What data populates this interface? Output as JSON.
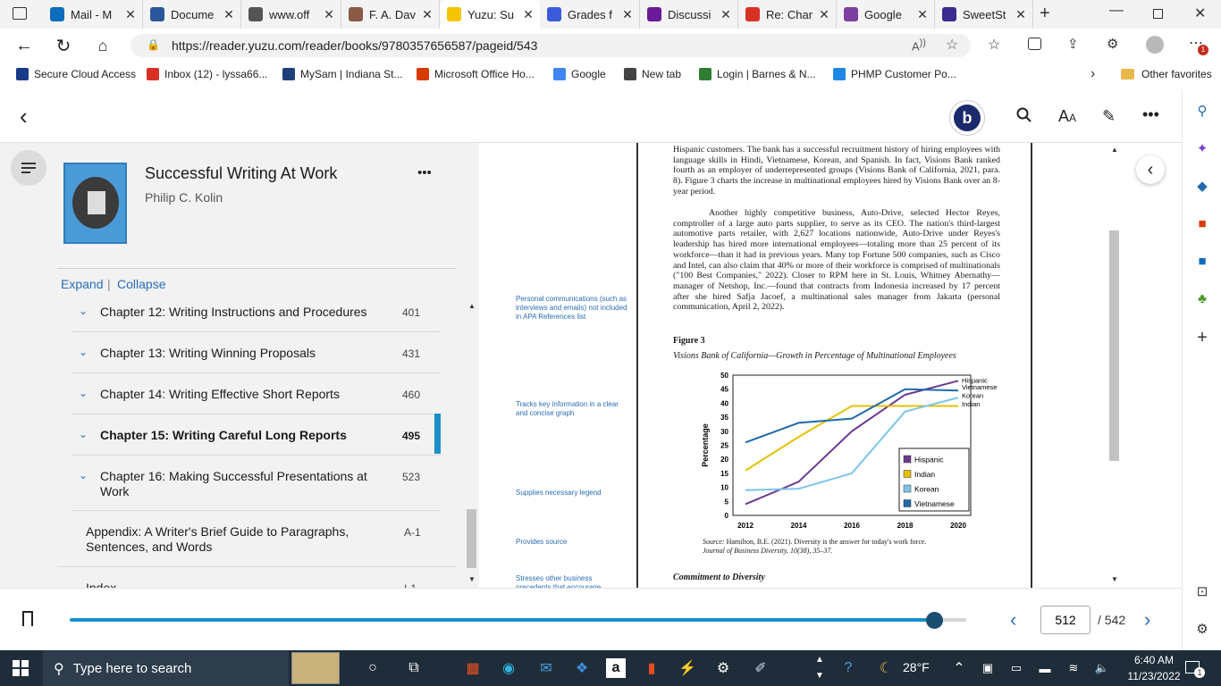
{
  "browser": {
    "tabs": [
      {
        "title": "Mail - M",
        "favicon": "outlook-icon",
        "color": "#0f6cbd"
      },
      {
        "title": "Docume",
        "favicon": "word-icon",
        "color": "#2b579a"
      },
      {
        "title": "www.off",
        "favicon": "document-icon",
        "color": "#555555"
      },
      {
        "title": "F. A. Dav",
        "favicon": "fa-davis-icon",
        "color": "#8a5a44"
      },
      {
        "title": "Yuzu: Su",
        "favicon": "yuzu-icon",
        "color": "#f5c400"
      },
      {
        "title": "Grades f",
        "favicon": "canvas-icon",
        "color": "#3b5bdb"
      },
      {
        "title": "Discussi",
        "favicon": "discussion-icon",
        "color": "#6a1b9a"
      },
      {
        "title": "Re: Char",
        "favicon": "gmail-icon",
        "color": "#d93025"
      },
      {
        "title": "Google",
        "favicon": "google-icon",
        "color": "#7b3fa0"
      },
      {
        "title": "SweetSt",
        "favicon": "sweetstudy-icon",
        "color": "#3b2a8f"
      }
    ],
    "url": "https://reader.yuzu.com/reader/books/9780357656587/pageid/543",
    "bookmarks": [
      {
        "label": "Secure Cloud Access",
        "color": "#1a3a8a"
      },
      {
        "label": "Inbox (12) - lyssa66...",
        "color": "#d93025"
      },
      {
        "label": "MySam | Indiana St...",
        "color": "#1f3f7a"
      },
      {
        "label": "Microsoft Office Ho...",
        "color": "#d83b01"
      },
      {
        "label": "Google",
        "color": "#4285f4"
      },
      {
        "label": "New tab",
        "color": "#444444"
      },
      {
        "label": "Login | Barnes & N...",
        "color": "#2e7d32"
      },
      {
        "label": "PHMP Customer Po...",
        "color": "#1e88e5"
      }
    ],
    "other_favorites": "Other favorites"
  },
  "reader": {
    "back_icon": "chevron-left-icon",
    "brand_letter": "b",
    "book_title": "Successful Writing At Work",
    "author": "Philip C. Kolin",
    "more_label": "•••",
    "expand_label": "Expand",
    "collapse_label": "Collapse",
    "separator": "|",
    "chapters": [
      {
        "label": "Chapter 12: Writing Instructions and Procedures",
        "page": "401",
        "chevron": true,
        "active": false
      },
      {
        "label": "Chapter 13: Writing Winning Proposals",
        "page": "431",
        "chevron": true,
        "active": false
      },
      {
        "label": "Chapter 14: Writing Effective Short Reports",
        "page": "460",
        "chevron": true,
        "active": false
      },
      {
        "label": "Chapter 15: Writing Careful Long Reports",
        "page": "495",
        "chevron": true,
        "active": true
      },
      {
        "label": "Chapter 16: Making Successful Presentations at Work",
        "page": "523",
        "chevron": true,
        "active": false
      },
      {
        "label": "Appendix: A Writer's Brief Guide to Paragraphs, Sentences, and Words",
        "page": "A-1",
        "chevron": false,
        "active": false
      },
      {
        "label": "Index",
        "page": "I-1",
        "chevron": false,
        "active": false
      }
    ],
    "page_input": "512",
    "page_total": "/ 542",
    "progress": 0.965,
    "accent": "#1a8fc9"
  },
  "page": {
    "para1": "Hispanic customers. The bank has a successful recruitment history of hiring employees with language skills in Hindi, Vietnamese, Korean, and Spanish. In fact, Visions Bank ranked fourth as an employer of underrepresented groups (Visions Bank of California, 2021, para. 8). Figure 3 charts the increase in multinational employees hired by Visions Bank over an 8-year period.",
    "para2": "Another highly competitive business, Auto-Drive, selected Hector Reyes, comptroller of a large auto parts supplier, to serve as its CEO. The nation's third-largest automotive parts retailer, with 2,627 locations nationwide, Auto-Drive under Reyes's leadership has hired more international employees—totaling more than 25 percent of its workforce—than it had in previous years. Many top Fortune 500 companies, such as Cisco and Intel, can also claim that 40% or more of their workforce is comprised of multinationals (\"100 Best Companies,\" 2022). Closer to RPM here in St. Louis, Whitney Abernathy—manager of Netshop, Inc.—found that contracts from Indonesia increased by 17 percent after she hired Safja Jacoef, a multinational sales manager from Jakarta (personal communication, April 2, 2022).",
    "figure_label": "Figure 3",
    "figure_title": "Visions Bank of California—Growth in Percentage of Multinational Employees",
    "source_prefix": "Source:",
    "source_line1": "Hamilton, B.E. (2021). Diversity is the answer for today's work force.",
    "source_line2": "Journal of Business Diversity, 10(38), 35–37.",
    "section_heading": "Commitment to Diversity",
    "margin_notes": [
      "Personal communications (such as interviews and emails) not included in APA References list",
      "Tracks key information in a clear and concise graph",
      "Supplies necessary legend",
      "Provides source",
      "Stresses other business precedents that encourage"
    ]
  },
  "chart_data": {
    "type": "line",
    "x": [
      2012,
      2014,
      2016,
      2018,
      2020
    ],
    "ylabel": "Percentage",
    "ylim": [
      0,
      50
    ],
    "yticks": [
      0,
      5,
      10,
      15,
      20,
      25,
      30,
      35,
      40,
      45,
      50
    ],
    "series": [
      {
        "name": "Hispanic",
        "values": [
          4,
          12,
          30,
          43,
          48
        ],
        "color": "#6b3a8f"
      },
      {
        "name": "Indian",
        "values": [
          16,
          28,
          39,
          39,
          39
        ],
        "color": "#e6c100"
      },
      {
        "name": "Korean",
        "values": [
          9,
          9.5,
          15,
          37,
          42
        ],
        "color": "#7cc4ea"
      },
      {
        "name": "Vietnamese",
        "values": [
          26,
          33,
          34.5,
          45,
          44.5
        ],
        "color": "#1f6aab"
      }
    ],
    "legend": "bottom-right",
    "end_labels": [
      "Hispanic",
      "Vietnamese",
      "Korean",
      "Indian"
    ]
  },
  "taskbar": {
    "search_placeholder": "Type here to search",
    "temperature": "28°F",
    "time": "6:40 AM",
    "date": "11/23/2022",
    "notification_count": "1"
  }
}
